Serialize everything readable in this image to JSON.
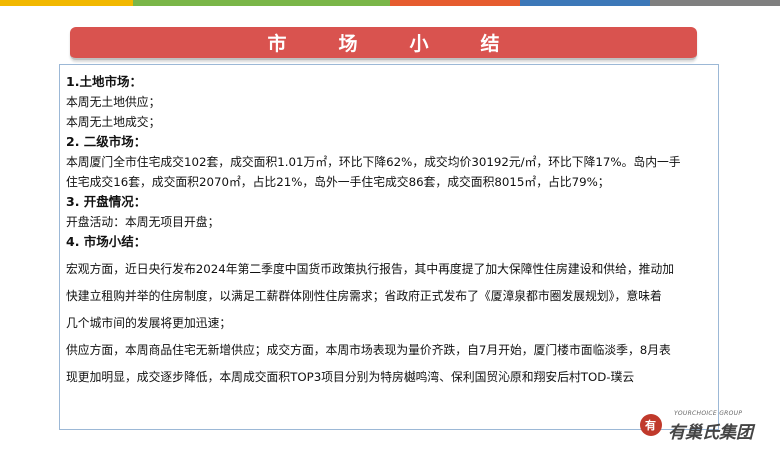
{
  "colors": {
    "topbar": [
      "#f2b800",
      "#f2b800",
      "#5ba3d0",
      "#7ab648",
      "#7ab648",
      "#e65c2f",
      "#3c78b8",
      "#7f7f7f",
      "#7f7f7f"
    ],
    "banner": "#d9534f"
  },
  "banner": {
    "title": "市场小结"
  },
  "sections": {
    "land": {
      "heading": "1.土地市场：",
      "lines": [
        "本周无土地供应；",
        "本周无土地成交；"
      ]
    },
    "secondary": {
      "heading": "2. 二级市场：",
      "lines": [
        "本周厦门全市住宅成交102套，成交面积1.01万㎡，环比下降62%，成交均价30192元/㎡，环比下降17%。岛内一手",
        "住宅成交16套，成交面积2070㎡，占比21%，岛外一手住宅成交86套，成交面积8015㎡，占比79%；"
      ]
    },
    "opening": {
      "heading": "3. 开盘情况：",
      "lines": [
        "开盘活动：本周无项目开盘；"
      ]
    },
    "summary": {
      "heading": "4. 市场小结：",
      "lines": [
        "宏观方面，近日央行发布2024年第二季度中国货币政策执行报告，其中再度提了加大保障性住房建设和供给，推动加",
        "快建立租购并举的住房制度，以满足工薪群体刚性住房需求；省政府正式发布了《厦漳泉都市圈发展规划》，意味着",
        "几个城市间的发展将更加迅速；",
        "供应方面，本周商品住宅无新增供应；成交方面，本周市场表现为量价齐跌，自7月开始，厦门楼市面临淡季，8月表",
        "现更加明显，成交逐步降低，本周成交面积TOP3项目分别为特房樾鸣湾、保利国贸沁原和翔安后村TOD-璞云"
      ]
    }
  },
  "logo": {
    "mark": "有",
    "english": "YOURCHOICE GROUP",
    "chinese": "有巢氏集团",
    "icon": "logo-icon"
  }
}
